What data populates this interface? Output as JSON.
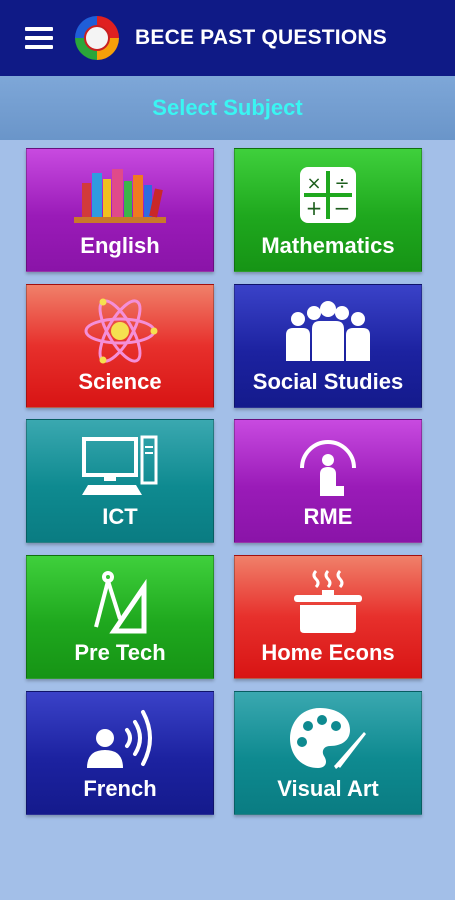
{
  "appbar": {
    "title": "BECE PAST QUESTIONS",
    "menu_icon": "menu-icon",
    "logo_icon": "app-logo-icon"
  },
  "subbar": {
    "text": "Select Subject"
  },
  "subjects": [
    {
      "label": "English",
      "icon": "books-icon",
      "color": "#9a1bb8"
    },
    {
      "label": "Mathematics",
      "icon": "calculator-icon",
      "color": "#1fa81e"
    },
    {
      "label": "Science",
      "icon": "atom-icon",
      "color": "#e7302c"
    },
    {
      "label": "Social Studies",
      "icon": "people-group-icon",
      "color": "#1c22a0"
    },
    {
      "label": "ICT",
      "icon": "computer-icon",
      "color": "#0e8a90"
    },
    {
      "label": "RME",
      "icon": "prayer-icon",
      "color": "#9a1bb8"
    },
    {
      "label": "Pre Tech",
      "icon": "drafting-tools-icon",
      "color": "#1fa81e"
    },
    {
      "label": "Home Econs",
      "icon": "cooking-pot-icon",
      "color": "#e7302c"
    },
    {
      "label": "French",
      "icon": "speaking-person-icon",
      "color": "#1c22a0"
    },
    {
      "label": "Visual Art",
      "icon": "palette-icon",
      "color": "#0e8a90"
    }
  ]
}
